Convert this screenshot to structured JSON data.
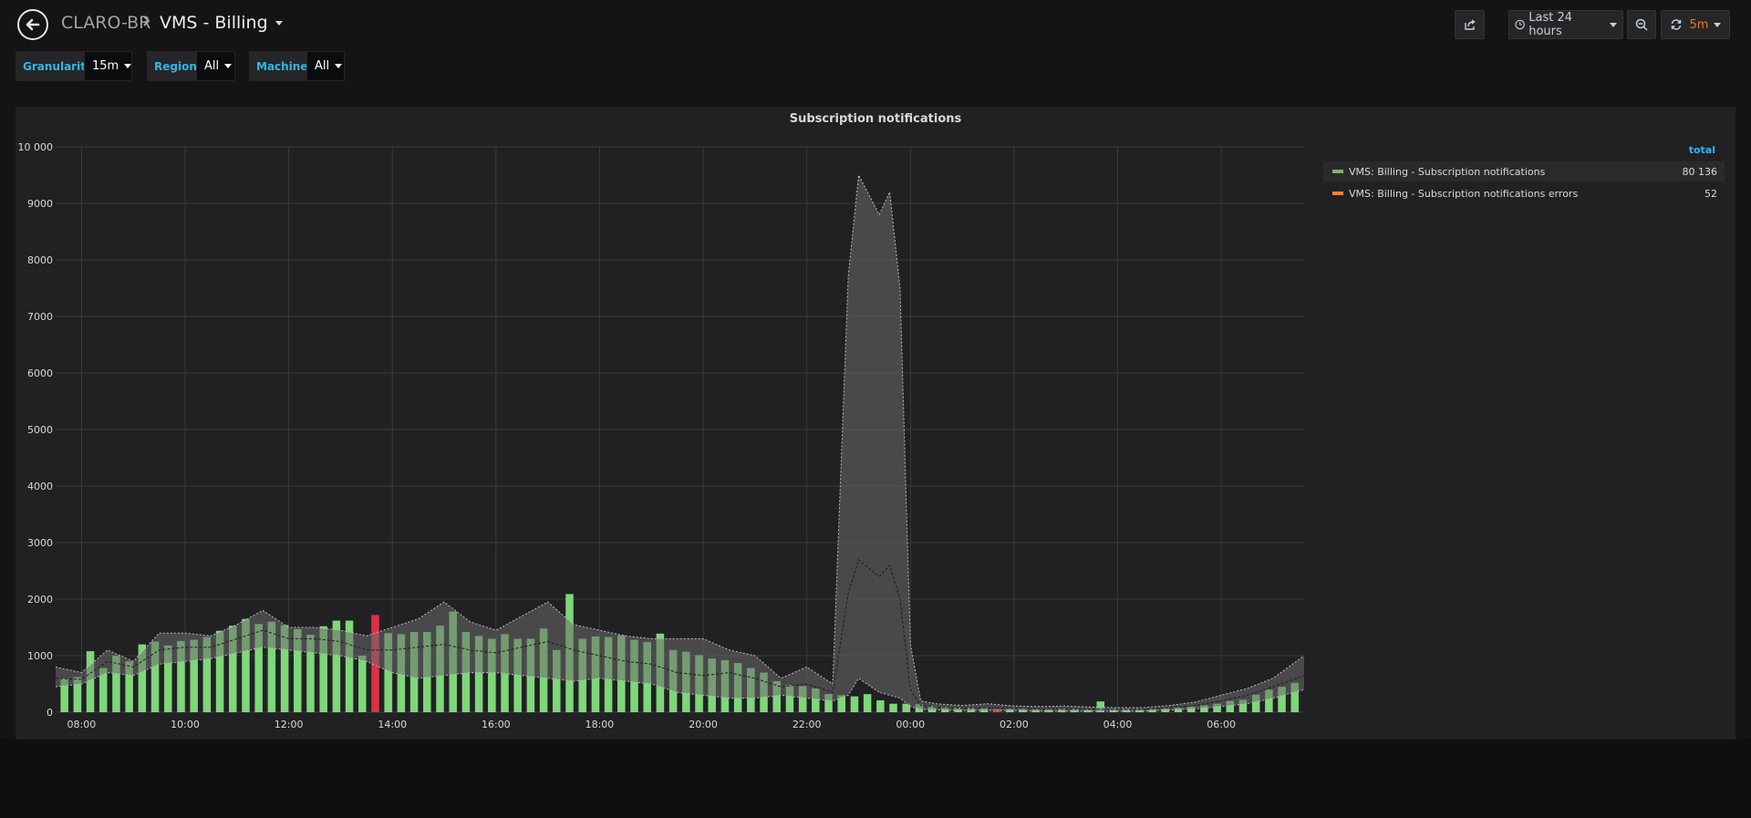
{
  "nav": {
    "org": "CLARO-BR",
    "separator": "›",
    "dashboard_title": "VMS - Billing",
    "time_range": "Last 24 hours",
    "refresh_interval": "5m"
  },
  "variables": [
    {
      "label": "Granularity",
      "value": "15m"
    },
    {
      "label": "Region",
      "value": "All"
    },
    {
      "label": "Machine",
      "value": "All"
    }
  ],
  "panel": {
    "title": "Subscription notifications",
    "legend": {
      "column_header": "total",
      "items": [
        {
          "name": "VMS: Billing - Subscription notifications",
          "total": "80 136",
          "color": "#7eb26d"
        },
        {
          "name": "VMS: Billing - Subscription notifications errors",
          "total": "52",
          "color": "#ef843c"
        }
      ]
    }
  },
  "colors": {
    "bar": "#7ed779",
    "bar_alert": "#e02f44",
    "band": "#6b6b6b",
    "grid": "#3b3b3d",
    "text": "#d8d9da"
  },
  "chart_data": {
    "type": "bar",
    "title": "Subscription notifications",
    "ylim": [
      0,
      10000
    ],
    "y_ticks": [
      "0",
      "1000",
      "2000",
      "3000",
      "4000",
      "5000",
      "6000",
      "7000",
      "8000",
      "9000",
      "10 000"
    ],
    "x_ticks": [
      "08:00",
      "10:00",
      "12:00",
      "14:00",
      "16:00",
      "18:00",
      "20:00",
      "22:00",
      "00:00",
      "02:00",
      "04:00",
      "06:00"
    ],
    "x_start_hours": 7.5,
    "x_end_hours": 31.6,
    "bar_width_hours": 0.15,
    "series": [
      {
        "name": "VMS: Billing - Subscription notifications",
        "time_hours": [
          7.67,
          7.92,
          8.17,
          8.42,
          8.67,
          8.92,
          9.17,
          9.42,
          9.67,
          9.92,
          10.17,
          10.42,
          10.67,
          10.92,
          11.17,
          11.42,
          11.67,
          11.92,
          12.17,
          12.42,
          12.67,
          12.92,
          13.17,
          13.42,
          13.67,
          13.92,
          14.17,
          14.42,
          14.67,
          14.92,
          15.17,
          15.42,
          15.67,
          15.92,
          16.17,
          16.42,
          16.67,
          16.92,
          17.17,
          17.42,
          17.67,
          17.92,
          18.17,
          18.42,
          18.67,
          18.92,
          19.17,
          19.42,
          19.67,
          19.92,
          20.17,
          20.42,
          20.67,
          20.92,
          21.17,
          21.42,
          21.67,
          21.92,
          22.17,
          22.42,
          22.67,
          22.92,
          23.17,
          23.42,
          23.67,
          23.92,
          24.17,
          24.42,
          24.67,
          24.92,
          25.17,
          25.42,
          25.67,
          25.92,
          26.17,
          26.42,
          26.67,
          26.92,
          27.17,
          27.42,
          27.67,
          27.92,
          28.17,
          28.42,
          28.67,
          28.92,
          29.17,
          29.42,
          29.67,
          29.92,
          30.17,
          30.42,
          30.67,
          30.92,
          31.17,
          31.42
        ],
        "values": [
          600,
          620,
          1080,
          780,
          1000,
          900,
          1200,
          1250,
          1180,
          1260,
          1280,
          1330,
          1440,
          1530,
          1650,
          1560,
          1600,
          1540,
          1470,
          1370,
          1520,
          1620,
          1620,
          1000,
          1720,
          1400,
          1380,
          1420,
          1420,
          1530,
          1780,
          1420,
          1350,
          1300,
          1380,
          1300,
          1300,
          1480,
          1100,
          2090,
          1300,
          1340,
          1330,
          1360,
          1280,
          1240,
          1390,
          1100,
          1070,
          1010,
          950,
          920,
          870,
          780,
          700,
          550,
          480,
          460,
          420,
          320,
          300,
          280,
          320,
          210,
          150,
          150,
          140,
          110,
          90,
          80,
          80,
          70,
          60,
          60,
          60,
          50,
          50,
          60,
          60,
          50,
          190,
          60,
          60,
          50,
          60,
          70,
          80,
          100,
          120,
          150,
          200,
          220,
          310,
          400,
          450,
          520
        ],
        "alert_times": [
          13.67,
          25.67
        ]
      },
      {
        "name": "upper band",
        "time_hours": [
          7.5,
          8.0,
          8.5,
          9.0,
          9.5,
          10.0,
          10.5,
          11.0,
          11.5,
          12.0,
          12.5,
          13.0,
          13.5,
          14.0,
          14.5,
          15.0,
          15.5,
          16.0,
          16.5,
          17.0,
          17.5,
          18.0,
          18.5,
          19.0,
          19.5,
          20.0,
          20.5,
          21.0,
          21.5,
          22.0,
          22.5,
          22.8,
          23.0,
          23.4,
          23.6,
          23.8,
          24.0,
          24.2,
          24.5,
          25.0,
          25.5,
          26.0,
          26.5,
          27.0,
          27.5,
          28.0,
          28.5,
          29.0,
          29.5,
          30.0,
          30.5,
          31.0,
          31.6
        ],
        "values": [
          800,
          700,
          1100,
          900,
          1400,
          1400,
          1350,
          1550,
          1800,
          1500,
          1500,
          1450,
          1350,
          1500,
          1650,
          1950,
          1600,
          1450,
          1700,
          1950,
          1550,
          1450,
          1350,
          1300,
          1300,
          1300,
          1100,
          1000,
          600,
          800,
          500,
          7700,
          9500,
          8800,
          9200,
          7500,
          1200,
          200,
          150,
          120,
          150,
          110,
          100,
          110,
          90,
          80,
          80,
          120,
          180,
          300,
          420,
          600,
          1000
        ]
      },
      {
        "name": "lower band",
        "time_hours": [
          7.5,
          8.0,
          8.5,
          9.0,
          9.5,
          10.0,
          10.5,
          11.0,
          11.5,
          12.0,
          12.5,
          13.0,
          13.5,
          14.0,
          14.5,
          15.0,
          15.5,
          16.0,
          16.5,
          17.0,
          17.5,
          18.0,
          18.5,
          19.0,
          19.5,
          20.0,
          20.5,
          21.0,
          21.5,
          22.0,
          22.5,
          22.8,
          23.0,
          23.4,
          23.6,
          23.8,
          24.0,
          24.2,
          24.5,
          25.0,
          25.5,
          26.0,
          26.5,
          27.0,
          27.5,
          28.0,
          28.5,
          29.0,
          29.5,
          30.0,
          30.5,
          31.0,
          31.6
        ],
        "values": [
          450,
          500,
          700,
          650,
          850,
          900,
          950,
          1050,
          1150,
          1100,
          1050,
          1000,
          900,
          700,
          600,
          650,
          700,
          700,
          650,
          600,
          550,
          600,
          550,
          500,
          350,
          300,
          250,
          250,
          300,
          250,
          200,
          300,
          600,
          350,
          300,
          250,
          100,
          50,
          40,
          30,
          30,
          30,
          20,
          20,
          20,
          20,
          20,
          40,
          60,
          100,
          150,
          250,
          400
        ]
      },
      {
        "name": "average",
        "time_hours": [
          7.5,
          8.0,
          8.5,
          9.0,
          9.5,
          10.0,
          10.5,
          11.0,
          11.5,
          12.0,
          12.5,
          13.0,
          13.5,
          14.0,
          14.5,
          15.0,
          15.5,
          16.0,
          16.5,
          17.0,
          17.5,
          18.0,
          18.5,
          19.0,
          19.5,
          20.0,
          20.5,
          21.0,
          21.5,
          22.0,
          22.5,
          22.8,
          23.0,
          23.4,
          23.6,
          23.8,
          24.0,
          24.2,
          24.5,
          25.0,
          25.5,
          26.0,
          26.5,
          27.0,
          27.5,
          28.0,
          28.5,
          29.0,
          29.5,
          30.0,
          30.5,
          31.0,
          31.6
        ],
        "values": [
          600,
          580,
          900,
          800,
          1100,
          1150,
          1150,
          1300,
          1450,
          1300,
          1300,
          1250,
          1100,
          1100,
          1150,
          1200,
          1100,
          1050,
          1150,
          1250,
          1100,
          1000,
          900,
          850,
          700,
          650,
          700,
          600,
          450,
          500,
          350,
          2100,
          2700,
          2400,
          2600,
          2000,
          400,
          120,
          90,
          70,
          80,
          70,
          60,
          60,
          50,
          50,
          50,
          80,
          120,
          200,
          300,
          450,
          650
        ]
      }
    ]
  }
}
